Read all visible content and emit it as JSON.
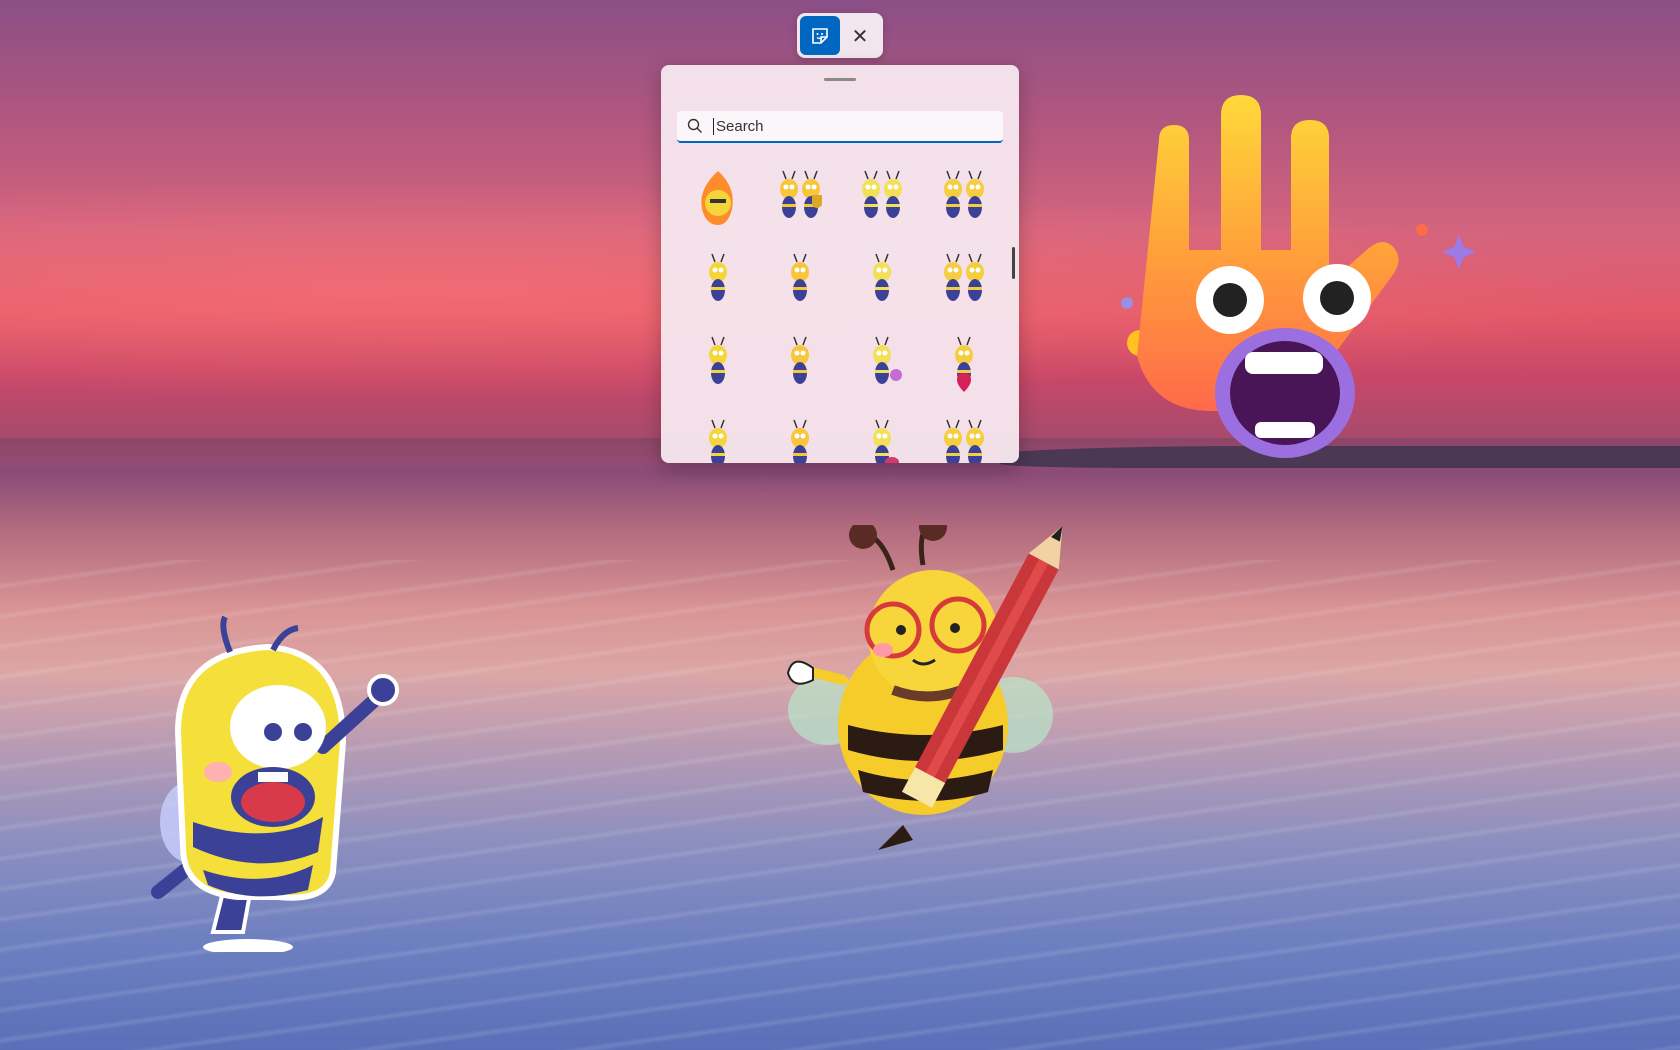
{
  "toolbar": {
    "sticker_button": "sticker-icon",
    "close_button": "close-icon",
    "close_glyph": "✕"
  },
  "panel": {
    "search": {
      "placeholder": "Search",
      "value": ""
    },
    "stickers": [
      "bee-flame",
      "bee-trophy",
      "bee-crowd",
      "bee-pair",
      "bee-grumpy",
      "bee-standing",
      "bee-waving",
      "bee-highfive",
      "bee-laughing",
      "bee-thumbs-up",
      "bee-flower",
      "bee-location-pin",
      "bee-sparkle",
      "bee-running",
      "bee-guitar",
      "bee-group"
    ]
  },
  "desktop_stickers": [
    "hand-face-sticker",
    "yellow-bee-sticker",
    "pencil-bee-sticker"
  ],
  "colors": {
    "accent": "#0067c0",
    "panel_bg": "#f6e6ee"
  }
}
